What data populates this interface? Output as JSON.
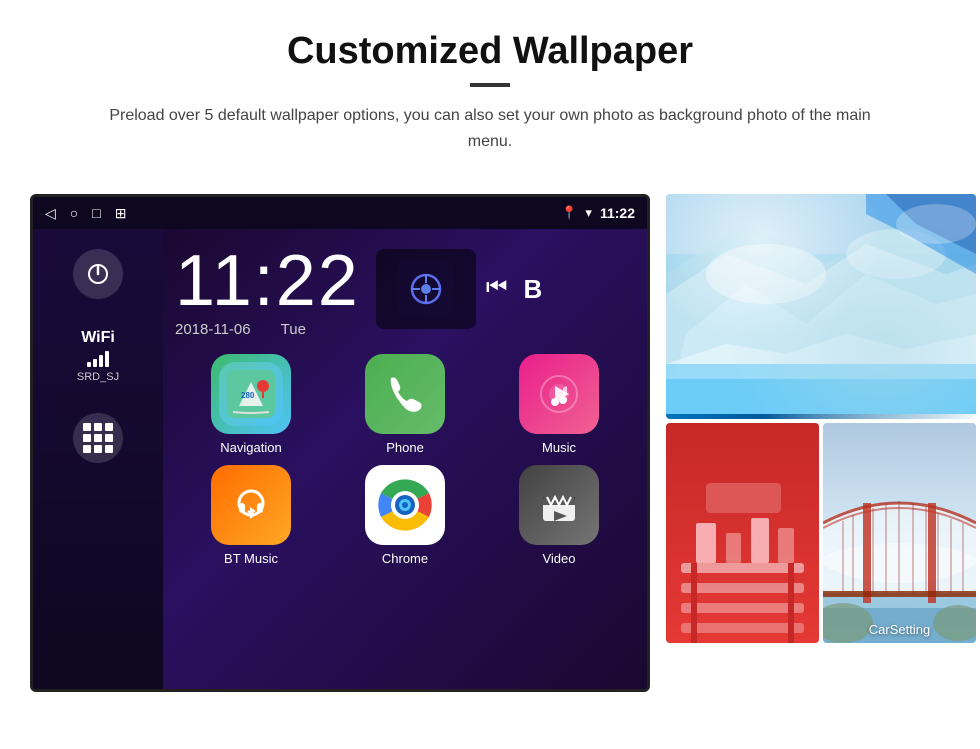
{
  "page": {
    "title": "Customized Wallpaper",
    "divider": "—",
    "description": "Preload over 5 default wallpaper options, you can also set your own photo as background photo of the main menu."
  },
  "status_bar": {
    "time": "11:22",
    "nav_icons": [
      "◁",
      "○",
      "□",
      "⊞"
    ],
    "right_icons": [
      "📍",
      "▼"
    ]
  },
  "clock": {
    "time": "11:22",
    "date": "2018-11-06",
    "day": "Tue"
  },
  "wifi": {
    "label": "WiFi",
    "ssid": "SRD_SJ"
  },
  "apps": [
    {
      "id": "navigation",
      "label": "Navigation",
      "type": "nav"
    },
    {
      "id": "phone",
      "label": "Phone",
      "type": "phone"
    },
    {
      "id": "music",
      "label": "Music",
      "type": "music"
    },
    {
      "id": "bt-music",
      "label": "BT Music",
      "type": "bt"
    },
    {
      "id": "chrome",
      "label": "Chrome",
      "type": "chrome"
    },
    {
      "id": "video",
      "label": "Video",
      "type": "video"
    }
  ],
  "carsetting_label": "CarSetting",
  "accent_color": "#111111"
}
